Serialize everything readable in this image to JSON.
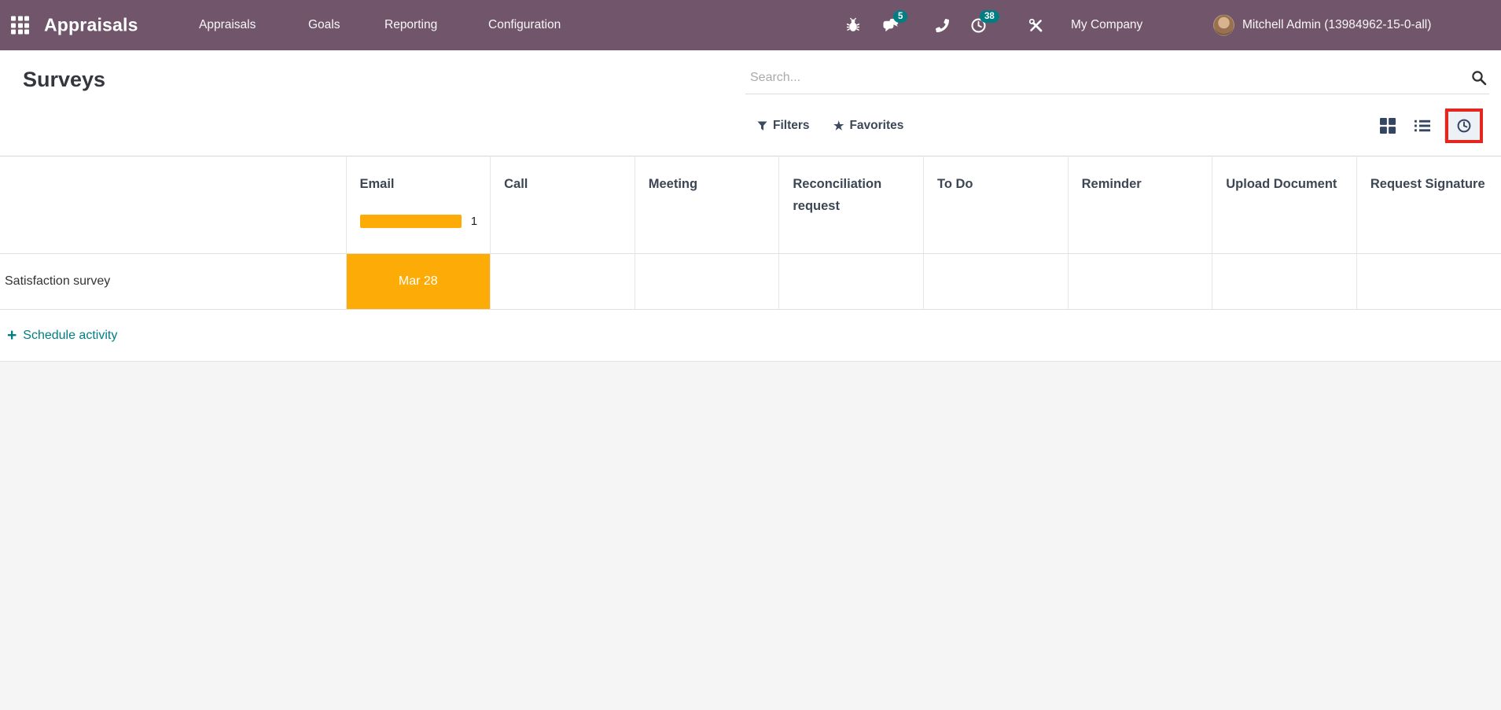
{
  "navbar": {
    "app_title": "Appraisals",
    "menu": {
      "appraisals": "Appraisals",
      "goals": "Goals",
      "reporting": "Reporting",
      "configuration": "Configuration"
    },
    "messages_badge": "5",
    "activities_badge": "38",
    "company": "My Company",
    "user": "Mitchell Admin (13984962-15-0-all)"
  },
  "control_panel": {
    "title": "Surveys",
    "search_placeholder": "Search...",
    "filters_label": "Filters",
    "favorites_label": "Favorites"
  },
  "icons": {
    "apps": "grid-3x3",
    "bug": "bug",
    "messages": "chat-bubbles",
    "phone": "phone-handset",
    "activities": "clock",
    "tools": "wrench-screwdriver",
    "search": "magnifier",
    "filters": "funnel",
    "favorites": "star",
    "kanban_view": "th-large",
    "list_view": "list-bullets",
    "activity_view": "clock"
  },
  "glyphs": {
    "star": "★",
    "plus": "+"
  },
  "activity_table": {
    "columns": [
      "Email",
      "Call",
      "Meeting",
      "Reconciliation request",
      "To Do",
      "Reminder",
      "Upload Document",
      "Request Signature"
    ],
    "email_count": "1",
    "rows": [
      {
        "name": "Satisfaction survey",
        "email_due": "Mar 28"
      }
    ],
    "schedule_label": "Schedule activity"
  },
  "annotation": {
    "highlighted_element": "activity-view-button"
  },
  "colors": {
    "navbar_bg": "#71566B",
    "badge_teal": "#017E84",
    "link_teal": "#017E84",
    "activity_today": "#FCAB07",
    "annotation_red": "#E3261E"
  }
}
